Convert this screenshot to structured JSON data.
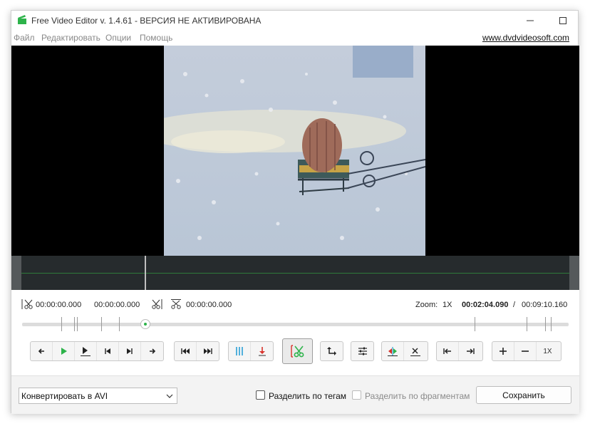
{
  "window": {
    "title": "Free Video Editor v. 1.4.61 - ВЕРСИЯ НЕ АКТИВИРОВАНА",
    "minimize_icon": "minimize-icon",
    "maximize_icon": "maximize-icon",
    "close_icon": "close-icon"
  },
  "menu": {
    "items": [
      "Файл",
      "Редактировать",
      "Опции",
      "Помощь"
    ],
    "site_link": "www.dvdvideosoft.com"
  },
  "timecodes": {
    "start": "00:00:00.000",
    "end": "00:00:00.000",
    "selection": "00:00:00.000",
    "zoom_label": "Zoom:",
    "zoom_value": "1X",
    "current": "00:02:04.090",
    "separator": "/",
    "total": "00:09:10.160"
  },
  "playback": {
    "position_fraction": 0.225
  },
  "toolbar": {
    "zoom_reset_label": "1X"
  },
  "bottom": {
    "format_selected": "Конвертировать в AVI",
    "split_by_tags_label": "Разделить по тегам",
    "split_by_tags_checked": false,
    "split_by_fragments_label": "Разделить по фрагментам",
    "split_by_fragments_enabled": false,
    "save_label": "Сохранить"
  },
  "colors": {
    "accent_green": "#2db34a",
    "accent_red": "#d9322b",
    "accent_blue": "#2a9fd6"
  }
}
